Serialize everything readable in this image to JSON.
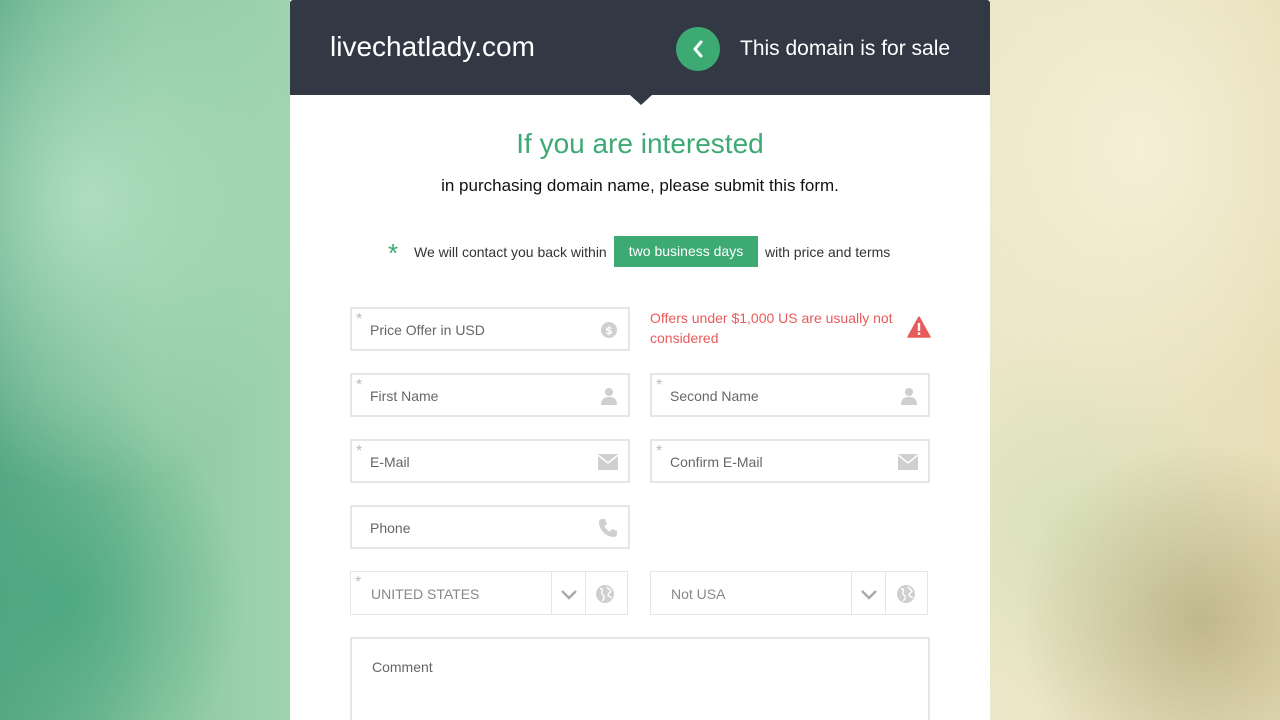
{
  "header": {
    "domain": "livechatlady.com",
    "sale_text": "This domain is for sale"
  },
  "intro": {
    "headline": "If you are interested",
    "subline": "in purchasing domain name, please submit this form."
  },
  "contact_note": {
    "star": "*",
    "before": "We will contact you back within",
    "highlight": "two business days",
    "after": "with price and terms"
  },
  "form": {
    "required_mark": "*",
    "price": {
      "placeholder": "Price Offer in USD",
      "icon": "dollar-icon"
    },
    "warning": {
      "text": "Offers under $1,000 US are usually not considered",
      "icon": "warning-icon"
    },
    "first_name": {
      "placeholder": "First Name",
      "icon": "user-icon"
    },
    "second_name": {
      "placeholder": "Second Name",
      "icon": "user-icon"
    },
    "email": {
      "placeholder": "E-Mail",
      "icon": "envelope-icon"
    },
    "confirm_email": {
      "placeholder": "Confirm E-Mail",
      "icon": "envelope-icon"
    },
    "phone": {
      "placeholder": "Phone",
      "icon": "phone-icon"
    },
    "country": {
      "value": "UNITED STATES",
      "icon": "globe-icon"
    },
    "state": {
      "value": "Not USA",
      "icon": "globe-icon"
    },
    "comment": {
      "placeholder": "Comment"
    }
  },
  "colors": {
    "accent": "#3daa73",
    "header_bg": "#323844",
    "warning": "#e85b5b",
    "border": "#e6e6e6"
  }
}
